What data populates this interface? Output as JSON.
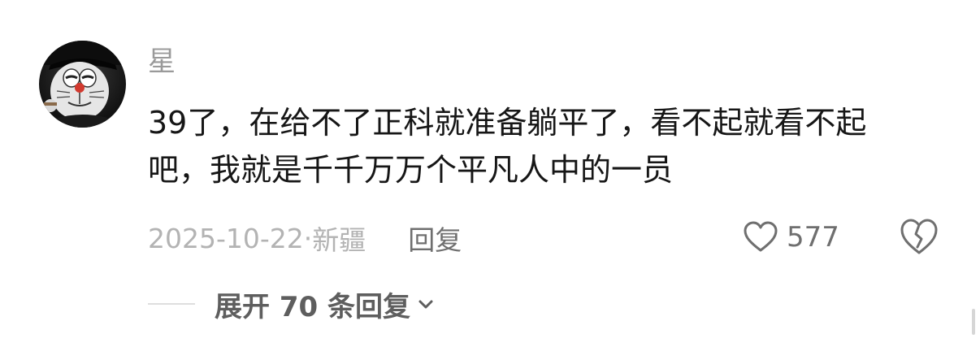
{
  "comment": {
    "username": "星",
    "text": "39了，在给不了正科就准备躺平了，看不起就看不起吧，我就是千千万万个平凡人中的一员",
    "date": "2025-10-22",
    "location_sep": "·",
    "location": "新疆",
    "reply_label": "回复",
    "likes": "577",
    "expand_label": "展开 70 条回复"
  },
  "icons": {
    "like": "heart-outline-icon",
    "dislike": "broken-heart-icon",
    "expand": "chevron-down-icon"
  },
  "colors": {
    "text": "#161616",
    "muted": "#9a9a9a",
    "meta": "#b3b3b3",
    "action": "#6f6f6f"
  }
}
